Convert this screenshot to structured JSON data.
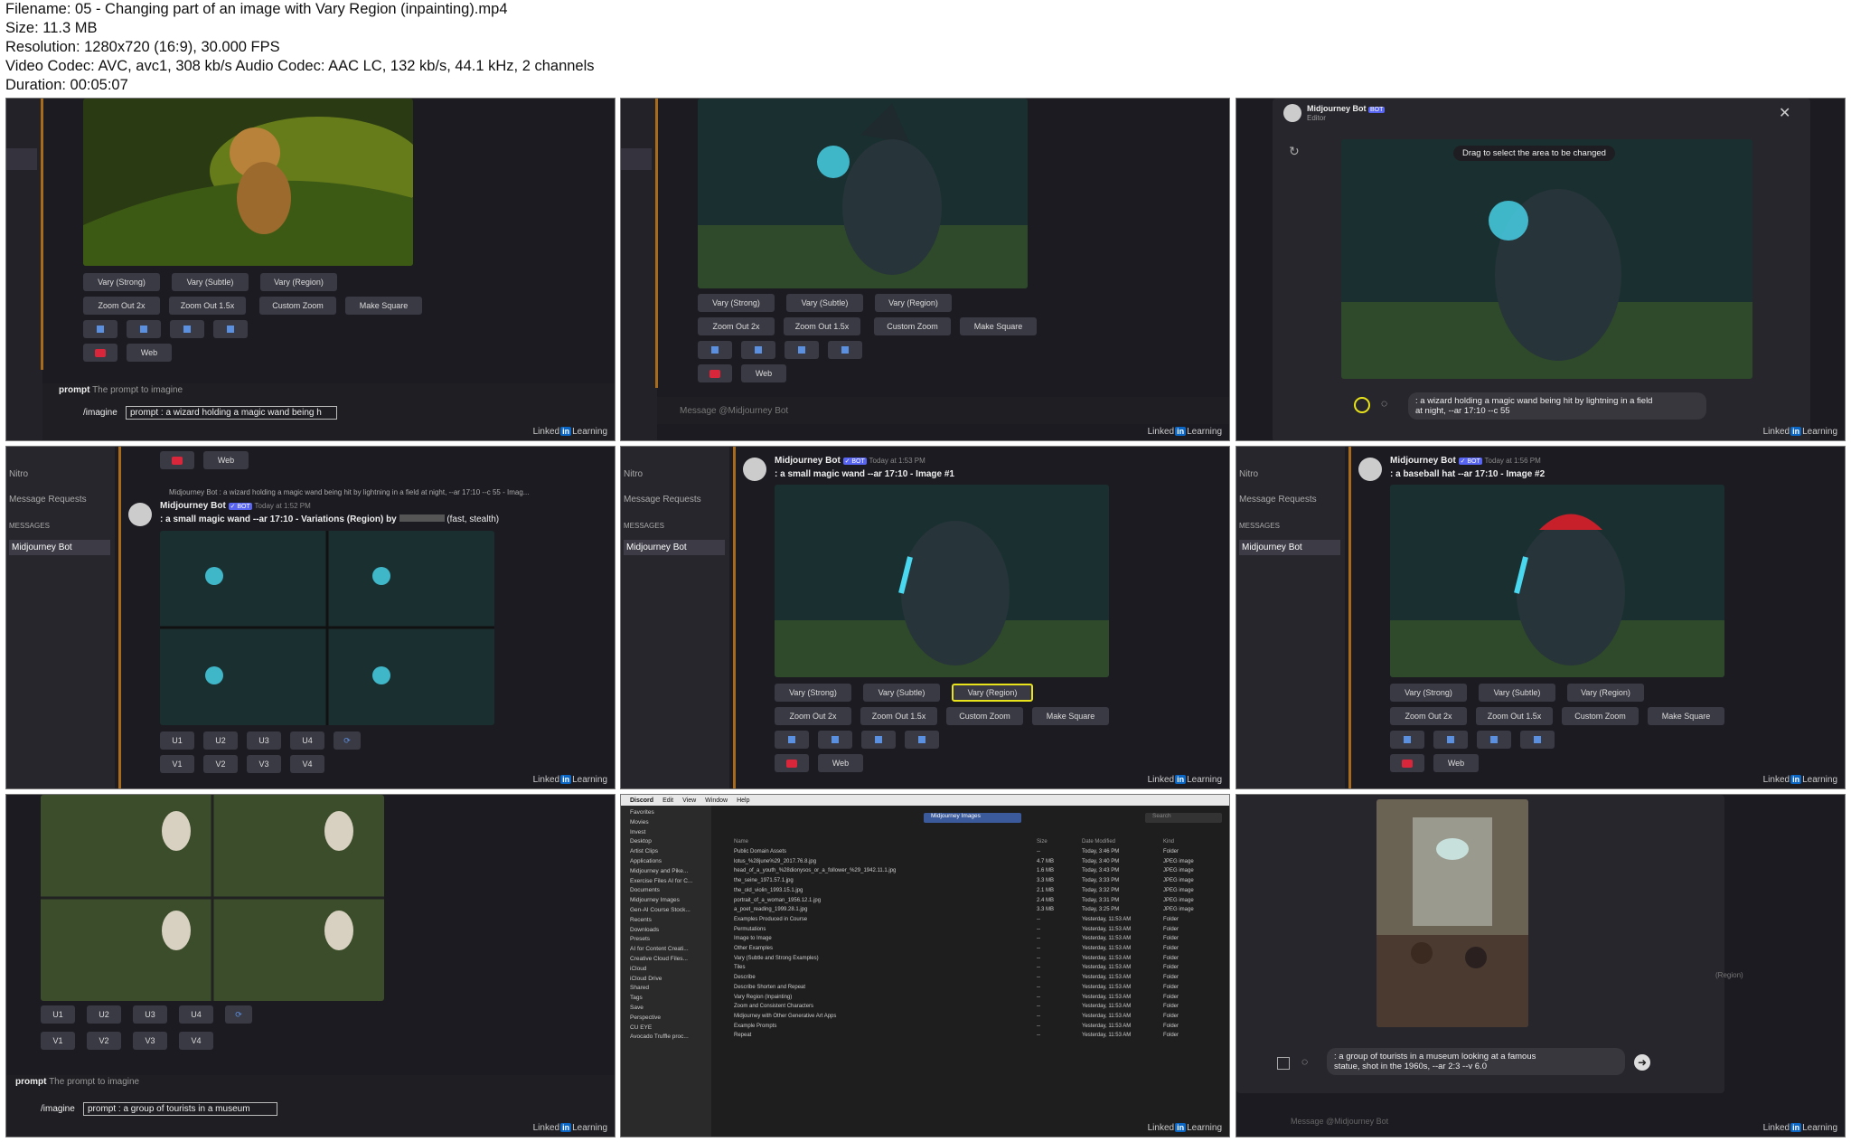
{
  "header": {
    "filename": "Filename: 05 - Changing part of an image with Vary Region (inpainting).mp4",
    "size": "Size: 11.3 MB",
    "resolution": "Resolution: 1280x720 (16:9), 30.000 FPS",
    "codec": "Video Codec: AVC, avc1, 308 kb/s Audio Codec: AAC LC, 132 kb/s, 44.1 kHz, 2 channels",
    "duration": "Duration: 00:05:07"
  },
  "watermark": {
    "left": "Linked",
    "in": "in",
    "right": "Learning"
  },
  "buttons": {
    "vary_strong": "Vary (Strong)",
    "vary_subtle": "Vary (Subtle)",
    "vary_region": "Vary (Region)",
    "zoom2": "Zoom Out 2x",
    "zoom15": "Zoom Out 1.5x",
    "custom_zoom": "Custom Zoom",
    "make_square": "Make Square",
    "web": "Web"
  },
  "upscale": {
    "u1": "U1",
    "u2": "U2",
    "u3": "U3",
    "u4": "U4",
    "v1": "V1",
    "v2": "V2",
    "v3": "V3",
    "v4": "V4"
  },
  "tile1": {
    "prompt_label": "prompt",
    "prompt_hint": "The prompt to imagine",
    "command": "/imagine",
    "field": "prompt",
    "value": ": a wizard holding a magic wand being h"
  },
  "tile2": {
    "message_placeholder": "Message @Midjourney Bot"
  },
  "tile3": {
    "bot": "Midjourney Bot",
    "editor": "Editor",
    "tooltip": "Drag to select the area to be changed",
    "prompt_line1": ": a wizard holding a magic wand being hit by lightning in a field",
    "prompt_line2": "at night, --ar 17:10 --c 55"
  },
  "tile4": {
    "nitro": "Nitro",
    "message_requests": "Message Requests",
    "messages_header": "MESSAGES",
    "dm": "Midjourney Bot",
    "reply_ref": "Midjourney Bot : a wizard holding a magic wand being hit by lightning in a field at night, --ar 17:10 --c 55 - Imag...",
    "bot": "Midjourney Bot",
    "time": "Today at 1:52 PM",
    "prompt": ": a small magic wand --ar 17:10 - Variations (Region) by",
    "suffix": "(fast, stealth)"
  },
  "tile5": {
    "nitro": "Nitro",
    "message_requests": "Message Requests",
    "messages_header": "MESSAGES",
    "dm": "Midjourney Bot",
    "bot": "Midjourney Bot",
    "time": "Today at 1:53 PM",
    "prompt": ": a small magic wand --ar 17:10 - Image #1"
  },
  "tile6": {
    "nitro": "Nitro",
    "message_requests": "Message Requests",
    "messages_header": "MESSAGES",
    "dm": "Midjourney Bot",
    "bot": "Midjourney Bot",
    "time": "Today at 1:56 PM",
    "prompt": ": a baseball hat --ar 17:10 - Image #2"
  },
  "tile7": {
    "prompt_label": "prompt",
    "prompt_hint": "The prompt to imagine",
    "command": "/imagine",
    "field": "prompt",
    "value": ": a group of tourists in a museum"
  },
  "tile8": {
    "menu": [
      "Discord",
      "Edit",
      "View",
      "Window",
      "Help"
    ],
    "folder": "Midjourney Images",
    "search": "Search",
    "cols": {
      "name": "Name",
      "size": "Size",
      "date": "Date Modified",
      "kind": "Kind"
    },
    "sidebar": [
      "Favorites",
      "Movies",
      "Invest",
      "Desktop",
      "Artist Clips",
      "Applications",
      "Midjourney and Pike...",
      "Exercise Files AI for C...",
      "Documents",
      "Midjourney Images",
      "Gen-AI Course Stock...",
      "Recents",
      "Downloads",
      "Presets",
      "AI for Content Creati...",
      "Creative Cloud Files...",
      "iCloud",
      "iCloud Drive",
      "Shared",
      "Tags",
      "Save",
      "Perspective",
      "CU EYE",
      "Avocado Truffle proc..."
    ],
    "rows": [
      {
        "name": "Public Domain Assets",
        "size": "--",
        "date": "Today, 3:46 PM",
        "kind": "Folder"
      },
      {
        "name": "lotus_%28june%29_2017.76.8.jpg",
        "size": "4.7 MB",
        "date": "Today, 3:40 PM",
        "kind": "JPEG image"
      },
      {
        "name": "head_of_a_youth_%28dionysos_or_a_follower_%29_1942.11.1.jpg",
        "size": "1.6 MB",
        "date": "Today, 3:43 PM",
        "kind": "JPEG image"
      },
      {
        "name": "the_seine_1971.57.1.jpg",
        "size": "3.3 MB",
        "date": "Today, 3:33 PM",
        "kind": "JPEG image"
      },
      {
        "name": "the_old_violin_1993.15.1.jpg",
        "size": "2.1 MB",
        "date": "Today, 3:32 PM",
        "kind": "JPEG image"
      },
      {
        "name": "portrait_of_a_woman_1956.12.1.jpg",
        "size": "2.4 MB",
        "date": "Today, 3:31 PM",
        "kind": "JPEG image"
      },
      {
        "name": "a_poet_reading_1999.28.1.jpg",
        "size": "3.3 MB",
        "date": "Today, 3:25 PM",
        "kind": "JPEG image"
      },
      {
        "name": "Examples Produced in Course",
        "size": "--",
        "date": "Yesterday, 11:53 AM",
        "kind": "Folder"
      },
      {
        "name": "Permutations",
        "size": "--",
        "date": "Yesterday, 11:53 AM",
        "kind": "Folder"
      },
      {
        "name": "Image to Image",
        "size": "--",
        "date": "Yesterday, 11:53 AM",
        "kind": "Folder"
      },
      {
        "name": "Other Examples",
        "size": "--",
        "date": "Yesterday, 11:53 AM",
        "kind": "Folder"
      },
      {
        "name": "Vary (Subtle and Strong Examples)",
        "size": "--",
        "date": "Yesterday, 11:53 AM",
        "kind": "Folder"
      },
      {
        "name": "Tiles",
        "size": "--",
        "date": "Yesterday, 11:53 AM",
        "kind": "Folder"
      },
      {
        "name": "Describe",
        "size": "--",
        "date": "Yesterday, 11:53 AM",
        "kind": "Folder"
      },
      {
        "name": "Describe Shorten and Repeat",
        "size": "--",
        "date": "Yesterday, 11:53 AM",
        "kind": "Folder"
      },
      {
        "name": "Vary Region (Inpainting)",
        "size": "--",
        "date": "Yesterday, 11:53 AM",
        "kind": "Folder"
      },
      {
        "name": "Zoom and Consistent Characters",
        "size": "--",
        "date": "Yesterday, 11:53 AM",
        "kind": "Folder"
      },
      {
        "name": "Midjourney with Other Generative Art Apps",
        "size": "--",
        "date": "Yesterday, 11:53 AM",
        "kind": "Folder"
      },
      {
        "name": "Example Prompts",
        "size": "--",
        "date": "Yesterday, 11:53 AM",
        "kind": "Folder"
      },
      {
        "name": "Repeat",
        "size": "--",
        "date": "Yesterday, 11:53 AM",
        "kind": "Folder"
      }
    ]
  },
  "tile9": {
    "prompt_line1": ": a group of tourists in a museum looking at a famous",
    "prompt_line2": "statue, shot in the 1960s, --ar 2:3 --v 6.0",
    "side_label": "(Region)",
    "message_placeholder": "Message @Midjourney Bot"
  }
}
